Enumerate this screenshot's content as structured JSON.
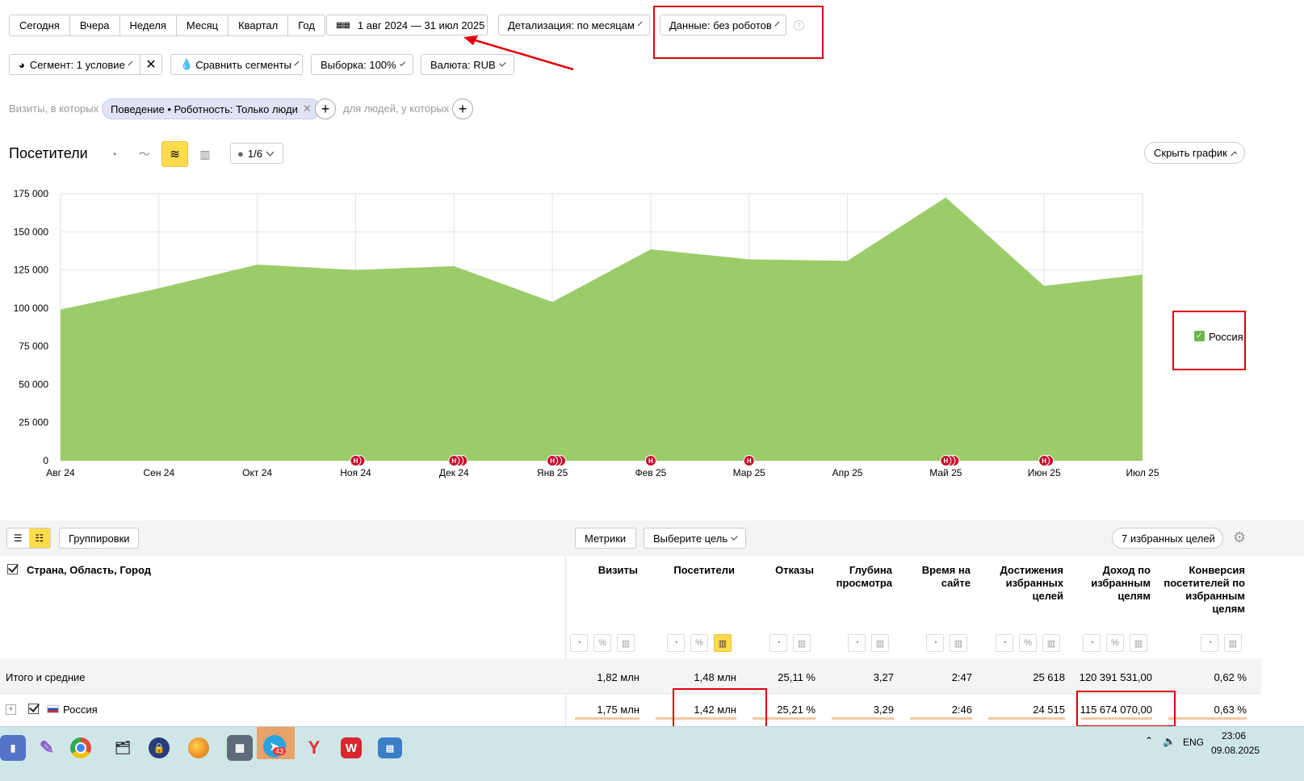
{
  "period_buttons": [
    "Сегодня",
    "Вчера",
    "Неделя",
    "Месяц",
    "Квартал",
    "Год"
  ],
  "date_range": "1 авг 2024 — 31 июл 2025",
  "detail_select": "Детализация: по месяцам",
  "data_select": "Данные: без роботов",
  "segment_select": "Сегмент: 1 условие",
  "compare_select": "Сравнить сегменты",
  "sample_select": "Выборка: 100%",
  "currency_select": "Валюта: RUB",
  "filter": {
    "prefix": "Визиты, в которых",
    "tag": "Поведение • Роботность: Только люди",
    "suffix": "для людей, у которых"
  },
  "chart_header": {
    "title": "Посетители",
    "annotations": "1/6",
    "hide_button": "Скрыть график"
  },
  "chart_data": {
    "type": "area",
    "title": "",
    "xlabel": "",
    "ylabel": "",
    "ylim": [
      0,
      175000
    ],
    "yticks": [
      "0",
      "25 000",
      "50 000",
      "75 000",
      "100 000",
      "125 000",
      "150 000",
      "175 000"
    ],
    "categories": [
      "Авг 24",
      "Сен 24",
      "Окт 24",
      "Ноя 24",
      "Дек 24",
      "Янв 25",
      "Фев 25",
      "Мар 25",
      "Апр 25",
      "Май 25",
      "Июн 25",
      "Июл 25"
    ],
    "series": [
      {
        "name": "Россия",
        "color": "#9ccc6a",
        "values": [
          99000,
          113000,
          128500,
          125000,
          127500,
          104000,
          138500,
          132000,
          131000,
          172500,
          114500,
          122000
        ]
      }
    ],
    "event_markers": [
      {
        "month": "Ноя 24",
        "count": 2
      },
      {
        "month": "Дек 24",
        "count": 3
      },
      {
        "month": "Янв 25",
        "count": 3
      },
      {
        "month": "Фев 25",
        "count": 1
      },
      {
        "month": "Мар 25",
        "count": 1
      },
      {
        "month": "Май 25",
        "count": 3
      },
      {
        "month": "Июн 25",
        "count": 2
      }
    ],
    "marker_letter": "Н",
    "grid": true,
    "legend_position": "right"
  },
  "table": {
    "groupings_button": "Группировки",
    "metrics_button": "Метрики",
    "goal_select": "Выберите цель",
    "favorites_button": "7 избранных целей",
    "dimension_header": "Страна, Область, Город",
    "columns": [
      "Визиты",
      "Посетители",
      "Отказы",
      "Глубина просмотра",
      "Время на сайте",
      "Достижения избранных целей",
      "Доход по избранным целям",
      "Конверсия посетителей по избранным целям"
    ],
    "totals": {
      "label": "Итого и средние",
      "values": [
        "1,82 млн",
        "1,48 млн",
        "25,11 %",
        "3,27",
        "2:47",
        "25 618",
        "120 391 531,00",
        "0,62 %"
      ]
    },
    "rows": [
      {
        "label": "Россия",
        "values": [
          "1,75 млн",
          "1,42 млн",
          "25,21 %",
          "3,29",
          "2:46",
          "24 515",
          "115 674 070,00",
          "0,63 %"
        ]
      }
    ]
  },
  "taskbar": {
    "telegram_badge": "43",
    "lang": "ENG",
    "time": "23:06",
    "date": "09.08.2025"
  }
}
